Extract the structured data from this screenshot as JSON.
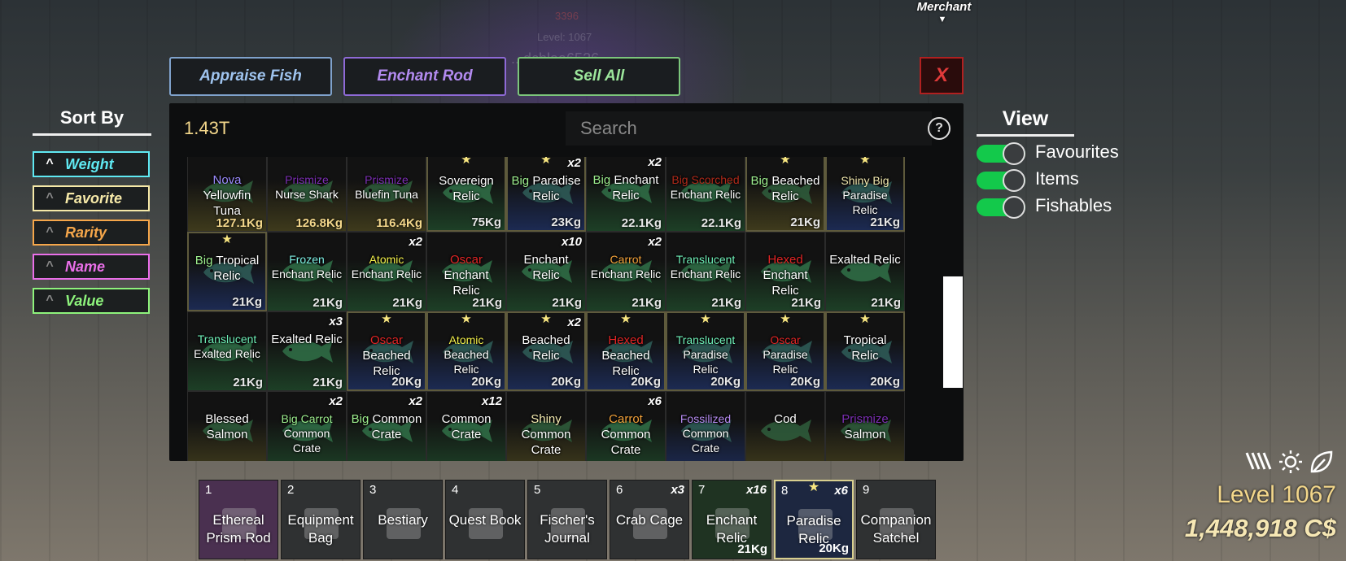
{
  "world": {
    "merchant_label": "Merchant",
    "faint_number": "3396",
    "faint_level": "Level: 1067",
    "faint_name": "...dchlaa6526"
  },
  "top_buttons": [
    {
      "label": "Appraise Fish",
      "color": "#9fc4ef",
      "border": "#7fa2cc"
    },
    {
      "label": "Enchant Rod",
      "color": "#b38bf0",
      "border": "#8e6ad6"
    },
    {
      "label": "Sell All",
      "color": "#9de79c",
      "border": "#7cc67b"
    }
  ],
  "close_label": "X",
  "inventory": {
    "currency": "1.43T",
    "search_placeholder": "Search",
    "help_label": "?"
  },
  "sort": {
    "title": "Sort By",
    "options": [
      {
        "label": "Weight",
        "color": "#5fe9f2",
        "caret": "^",
        "active": true
      },
      {
        "label": "Favorite",
        "color": "#f6e9a8",
        "caret": "^",
        "active": false
      },
      {
        "label": "Rarity",
        "color": "#f5a64a",
        "caret": "^",
        "active": false
      },
      {
        "label": "Name",
        "color": "#ea6fe9",
        "caret": "^",
        "active": false
      },
      {
        "label": "Value",
        "color": "#8ef37c",
        "caret": "^",
        "active": false
      }
    ]
  },
  "view": {
    "title": "View",
    "toggles": [
      {
        "label": "Favourites",
        "on": true
      },
      {
        "label": "Items",
        "on": true
      },
      {
        "label": "Fishables",
        "on": true
      }
    ]
  },
  "grid": [
    [
      {
        "mut": "Nova",
        "mutColor": "#9c8cff",
        "name": "Yellowfin Tuna",
        "wt": "127.1Kg",
        "bg": "yellow",
        "fav": false,
        "qty": ""
      },
      {
        "mut": "Prismize",
        "mutColor": "#7d2fb5",
        "name": "Nurse Shark",
        "wt": "126.8Kg",
        "bg": "yellow",
        "fav": false,
        "qty": ""
      },
      {
        "mut": "Prismize",
        "mutColor": "#7d2fb5",
        "name": "Bluefin Tuna",
        "wt": "116.4Kg",
        "bg": "yellow",
        "fav": false,
        "qty": ""
      },
      {
        "mut": "",
        "mutColor": "",
        "name": "Sovereign Relic",
        "wt": "75Kg",
        "bg": "green",
        "fav": true,
        "qty": ""
      },
      {
        "mut": "Big",
        "mutColor": "#9dee8e",
        "name": "Paradise Relic",
        "wt": "23Kg",
        "bg": "blue",
        "fav": true,
        "qty": "x2"
      },
      {
        "mut": "Big",
        "mutColor": "#9dee8e",
        "name": "Enchant Relic",
        "wt": "22.1Kg",
        "bg": "green",
        "fav": false,
        "qty": "x2"
      },
      {
        "mut": "Big Scorched",
        "mutColor": "#b02a1a",
        "name": "Enchant Relic",
        "wt": "22.1Kg",
        "bg": "green",
        "fav": false,
        "qty": ""
      },
      {
        "mut": "Big",
        "mutColor": "#9dee8e",
        "name": "Beached Relic",
        "wt": "21Kg",
        "bg": "yellow",
        "fav": true,
        "qty": ""
      },
      {
        "mut": "Shiny Big",
        "mutColor": "#f3eab0",
        "name": "Paradise Relic",
        "wt": "21Kg",
        "bg": "blue",
        "fav": true,
        "qty": ""
      }
    ],
    [
      {
        "mut": "Big",
        "mutColor": "#9dee8e",
        "name": "Tropical Relic",
        "wt": "21Kg",
        "bg": "blue",
        "fav": true,
        "qty": ""
      },
      {
        "mut": "Frozen",
        "mutColor": "#7ff0e4",
        "name": "Enchant Relic",
        "wt": "21Kg",
        "bg": "green",
        "fav": false,
        "qty": ""
      },
      {
        "mut": "Atomic",
        "mutColor": "#f3f04a",
        "name": "Enchant Relic",
        "wt": "21Kg",
        "bg": "green",
        "fav": false,
        "qty": "x2"
      },
      {
        "mut": "Oscar",
        "mutColor": "#e02525",
        "name": "Enchant Relic",
        "wt": "21Kg",
        "bg": "green",
        "fav": false,
        "qty": ""
      },
      {
        "mut": "",
        "mutColor": "",
        "name": "Enchant Relic",
        "wt": "21Kg",
        "bg": "green",
        "fav": false,
        "qty": "x10"
      },
      {
        "mut": "Carrot",
        "mutColor": "#f3a23a",
        "name": "Enchant Relic",
        "wt": "21Kg",
        "bg": "green",
        "fav": false,
        "qty": "x2"
      },
      {
        "mut": "Translucent",
        "mutColor": "#6ff0b8",
        "name": "Enchant Relic",
        "wt": "21Kg",
        "bg": "green",
        "fav": false,
        "qty": ""
      },
      {
        "mut": "Hexed",
        "mutColor": "#e02525",
        "name": "Enchant Relic",
        "wt": "21Kg",
        "bg": "green",
        "fav": false,
        "qty": ""
      },
      {
        "mut": "",
        "mutColor": "",
        "name": "Exalted Relic",
        "wt": "21Kg",
        "bg": "green",
        "fav": false,
        "qty": ""
      }
    ],
    [
      {
        "mut": "Translucent",
        "mutColor": "#6ff0b8",
        "name": "Exalted Relic",
        "wt": "21Kg",
        "bg": "green",
        "fav": false,
        "qty": ""
      },
      {
        "mut": "",
        "mutColor": "",
        "name": "Exalted Relic",
        "wt": "21Kg",
        "bg": "green",
        "fav": false,
        "qty": "x3"
      },
      {
        "mut": "Oscar",
        "mutColor": "#e02525",
        "name": "Beached Relic",
        "wt": "20Kg",
        "bg": "blue",
        "fav": true,
        "qty": ""
      },
      {
        "mut": "Atomic",
        "mutColor": "#f3f04a",
        "name": "Beached Relic",
        "wt": "20Kg",
        "bg": "blue",
        "fav": true,
        "qty": ""
      },
      {
        "mut": "",
        "mutColor": "",
        "name": "Beached Relic",
        "wt": "20Kg",
        "bg": "blue",
        "fav": true,
        "qty": "x2"
      },
      {
        "mut": "Hexed",
        "mutColor": "#e02525",
        "name": "Beached Relic",
        "wt": "20Kg",
        "bg": "blue",
        "fav": true,
        "qty": ""
      },
      {
        "mut": "Translucent",
        "mutColor": "#6ff0b8",
        "name": "Paradise Relic",
        "wt": "20Kg",
        "bg": "blue",
        "fav": true,
        "qty": ""
      },
      {
        "mut": "Oscar",
        "mutColor": "#e02525",
        "name": "Paradise Relic",
        "wt": "20Kg",
        "bg": "blue",
        "fav": true,
        "qty": ""
      },
      {
        "mut": "",
        "mutColor": "",
        "name": "Tropical Relic",
        "wt": "20Kg",
        "bg": "blue",
        "fav": true,
        "qty": ""
      }
    ],
    [
      {
        "mut": "",
        "mutColor": "",
        "name": "Blessed Salmon",
        "wt": "",
        "bg": "yellow",
        "fav": false,
        "qty": ""
      },
      {
        "mut": "Big Carrot",
        "mutColor": "#9dee8e",
        "name": "Common Crate",
        "wt": "",
        "bg": "green",
        "fav": false,
        "qty": "x2"
      },
      {
        "mut": "Big",
        "mutColor": "#9dee8e",
        "name": "Common Crate",
        "wt": "",
        "bg": "green",
        "fav": false,
        "qty": "x2"
      },
      {
        "mut": "",
        "mutColor": "",
        "name": "Common Crate",
        "wt": "",
        "bg": "green",
        "fav": false,
        "qty": "x12"
      },
      {
        "mut": "Shiny",
        "mutColor": "#f3eab0",
        "name": "Common Crate",
        "wt": "",
        "bg": "yellow",
        "fav": false,
        "qty": ""
      },
      {
        "mut": "Carrot",
        "mutColor": "#f3a23a",
        "name": "Common Crate",
        "wt": "",
        "bg": "green",
        "fav": false,
        "qty": "x6"
      },
      {
        "mut": "Fossilized",
        "mutColor": "#b58bf0",
        "name": "Common Crate",
        "wt": "",
        "bg": "blue",
        "fav": false,
        "qty": ""
      },
      {
        "mut": "",
        "mutColor": "",
        "name": "Cod",
        "wt": "",
        "bg": "yellow",
        "fav": false,
        "qty": ""
      },
      {
        "mut": "Prismize",
        "mutColor": "#7d2fb5",
        "name": "Salmon",
        "wt": "",
        "bg": "yellow",
        "fav": false,
        "qty": ""
      }
    ]
  ],
  "hotbar": [
    {
      "num": "1",
      "label": "Ethereal Prism Rod",
      "qty": "",
      "wt": "",
      "bg": "#4a3050",
      "sel": false,
      "fav": false
    },
    {
      "num": "2",
      "label": "Equipment Bag",
      "qty": "",
      "wt": "",
      "bg": "#2f3132",
      "sel": false,
      "fav": false
    },
    {
      "num": "3",
      "label": "Bestiary",
      "qty": "",
      "wt": "",
      "bg": "#2f3132",
      "sel": false,
      "fav": false
    },
    {
      "num": "4",
      "label": "Quest Book",
      "qty": "",
      "wt": "",
      "bg": "#2f3132",
      "sel": false,
      "fav": false
    },
    {
      "num": "5",
      "label": "Fischer's Journal",
      "qty": "",
      "wt": "",
      "bg": "#2f3132",
      "sel": false,
      "fav": false
    },
    {
      "num": "6",
      "label": "Crab Cage",
      "qty": "x3",
      "wt": "",
      "bg": "#2f3132",
      "sel": false,
      "fav": false
    },
    {
      "num": "7",
      "label": "Enchant Relic",
      "qty": "x16",
      "wt": "21Kg",
      "bg": "#1f3322",
      "sel": false,
      "fav": false
    },
    {
      "num": "8",
      "label": "Paradise Relic",
      "qty": "x6",
      "wt": "20Kg",
      "bg": "#1d2740",
      "sel": true,
      "fav": true
    },
    {
      "num": "9",
      "label": "Companion Satchel",
      "qty": "",
      "wt": "",
      "bg": "#2f3132",
      "sel": false,
      "fav": false
    }
  ],
  "status": {
    "level": "Level 1067",
    "cash": "1,448,918 C$"
  },
  "colors": {
    "accent_gold": "#f3d78b",
    "toggle_on": "#13c94b",
    "close_red": "#e03a3a"
  }
}
